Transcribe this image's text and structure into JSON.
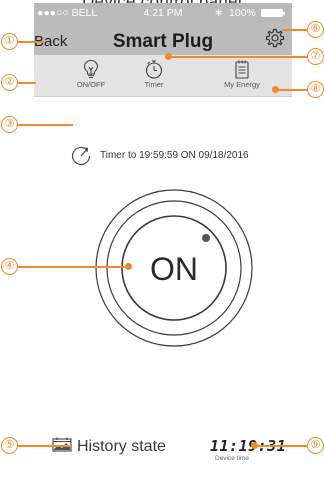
{
  "caption": "Device control panel",
  "status_bar": {
    "carrier": "●●●○○ BELL",
    "time": "4:21 PM",
    "battery": "100%"
  },
  "nav": {
    "back_label": "Back",
    "title": "Smart Plug"
  },
  "tabs": [
    {
      "label": "ON/OFF",
      "icon": "bulb-icon"
    },
    {
      "label": "Timer",
      "icon": "stopwatch-icon"
    },
    {
      "label": "My Energy",
      "icon": "notepad-icon"
    }
  ],
  "timer_text": "Timer to 19:59:59 ON 09/18/2016",
  "power_button_label": "ON",
  "history_label": "History state",
  "device_time": "11:19:31",
  "device_time_label": "Device time",
  "callouts": [
    "①",
    "②",
    "③",
    "④",
    "⑤",
    "⑥",
    "⑦",
    "⑧",
    "⑨"
  ],
  "colors": {
    "accent": "#f08a2a",
    "nav_bg": "#bcbcbc",
    "tab_bg": "#e3e3e3"
  }
}
